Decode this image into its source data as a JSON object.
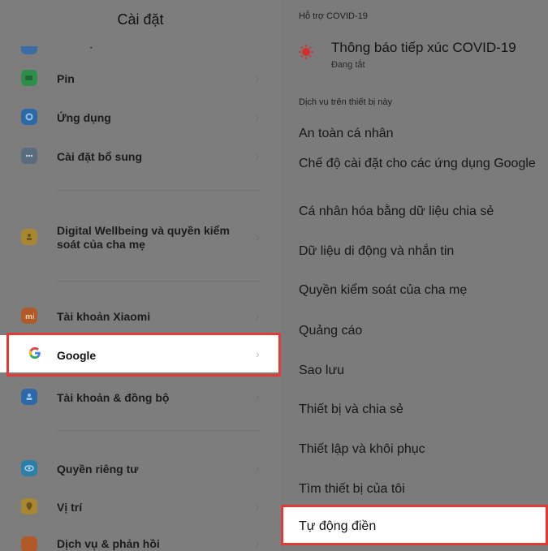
{
  "left": {
    "title": "Cài đặt",
    "clipped_item": "Bảo vệ cá nhân",
    "items": [
      {
        "label": "Pin"
      },
      {
        "label": "Ứng dụng"
      },
      {
        "label": "Cài đặt bổ sung"
      },
      {
        "label_line1": "Digital Wellbeing và quyền kiểm",
        "label_line2": "soát của cha mẹ"
      },
      {
        "label": "Tài khoản Xiaomi"
      },
      {
        "label": "Google"
      },
      {
        "label": "Tài khoản & đồng bộ"
      },
      {
        "label": "Quyền riêng tư"
      },
      {
        "label": "Vị trí"
      },
      {
        "label": "Dịch vụ & phản hồi"
      }
    ]
  },
  "right": {
    "section_covid": "Hỗ trợ COVID-19",
    "covid_title": "Thông báo tiếp xúc COVID-19",
    "covid_status": "Đang tắt",
    "section_device": "Dịch vụ trên thiết bị này",
    "items": [
      "An toàn cá nhân",
      "Chế độ cài đặt cho các ứng dụng Google",
      "Cá nhân hóa bằng dữ liệu chia sẻ",
      "Dữ liệu di động và nhắn tin",
      "Quyền kiểm soát của cha mẹ",
      "Quảng cáo",
      "Sao lưu",
      "Thiết bị và chia sẻ",
      "Thiết lập và khôi phục",
      "Tìm thiết bị của tôi",
      "Tự động điền"
    ]
  },
  "colors": {
    "highlight_border": "#e53935",
    "dim_overlay": "#7b7b7b"
  }
}
